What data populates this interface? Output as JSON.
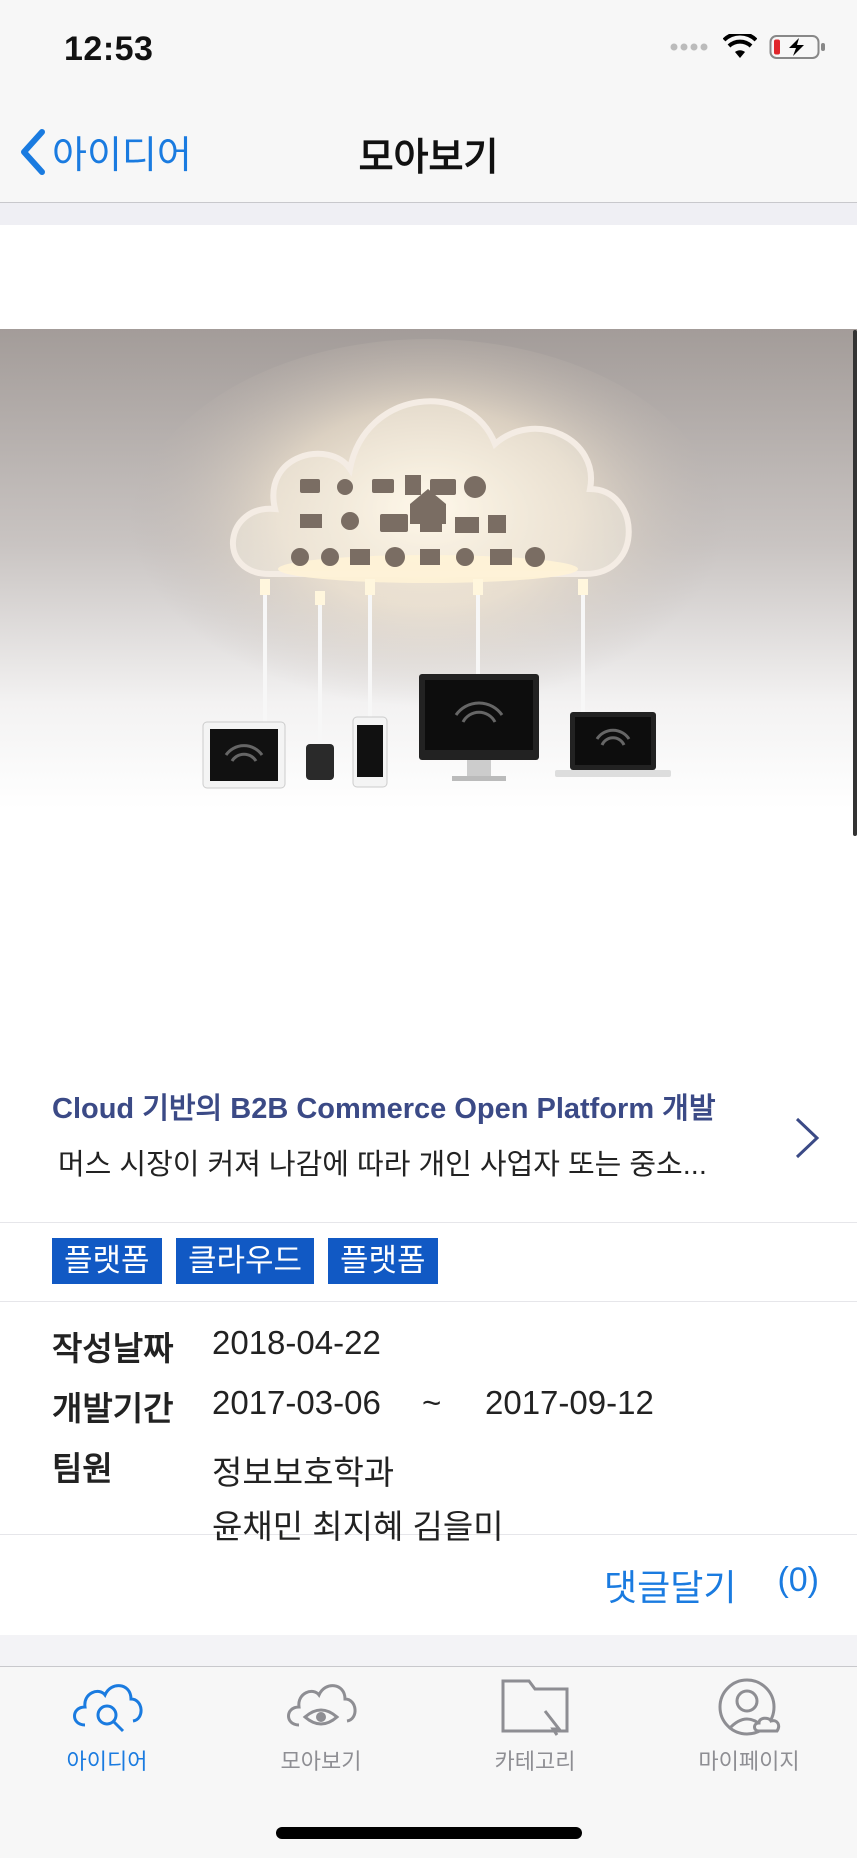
{
  "status": {
    "time": "12:53"
  },
  "nav": {
    "back_label": "아이디어",
    "title": "모아보기"
  },
  "post": {
    "title": "Cloud 기반의 B2B Commerce Open Platform 개발",
    "summary": "머스 시장이 커져 나감에 따라 개인 사업자 또는 중소...",
    "tags": [
      "플랫폼",
      "클라우드",
      "플랫폼"
    ],
    "fields": {
      "date_label": "작성날짜",
      "date_value": "2018-04-22",
      "period_label": "개발기간",
      "period_start": "2017-03-06",
      "period_sep": "~",
      "period_end": "2017-09-12",
      "team_label": "팀원",
      "team_dept": "정보보호학과",
      "team_members": "윤채민 최지혜 김을미"
    },
    "comment_label": "댓글달기",
    "comment_count": "(0)"
  },
  "tabs": [
    {
      "label": "아이디어",
      "icon": "cloud-search-icon",
      "active": true
    },
    {
      "label": "모아보기",
      "icon": "cloud-eye-icon",
      "active": false
    },
    {
      "label": "카테고리",
      "icon": "folder-cursor-icon",
      "active": false
    },
    {
      "label": "마이페이지",
      "icon": "person-cloud-icon",
      "active": false
    }
  ],
  "colors": {
    "accent": "#1a7be0",
    "tag_bg": "#1159c4",
    "title": "#3b4a86",
    "tab_inactive": "#8e8e93"
  }
}
